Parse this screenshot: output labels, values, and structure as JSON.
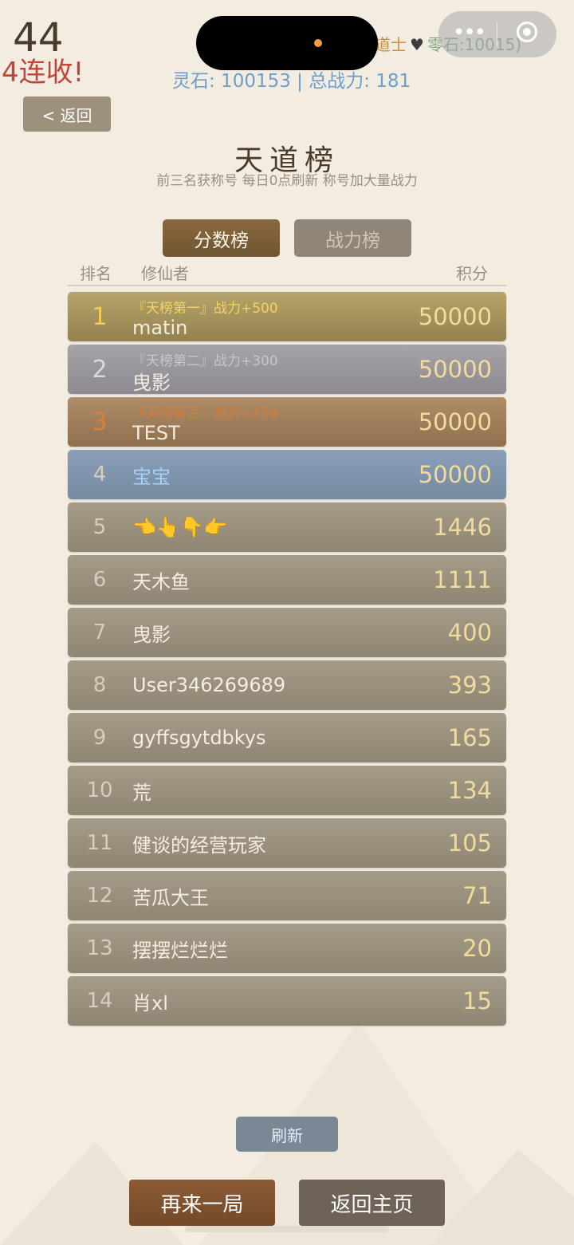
{
  "hud": {
    "score": "44",
    "streak": "4连收!",
    "status_title": "道士",
    "status_stone": "零石:10015",
    "status_stone_suffix": ")",
    "stats": "灵石: 100153 | 总战力: 181"
  },
  "back_label": "< 返回",
  "page": {
    "title": "天道榜",
    "subtitle": "前三名获称号 每日0点刷新 称号加大量战力"
  },
  "tabs": [
    {
      "label": "分数榜",
      "active": true
    },
    {
      "label": "战力榜",
      "active": false
    }
  ],
  "columns": {
    "rank": "排名",
    "player": "修仙者",
    "points": "积分"
  },
  "rows": [
    {
      "rank": "1",
      "title": "『天榜第一』战力+500",
      "name": "matin",
      "points": "50000"
    },
    {
      "rank": "2",
      "title": "『天榜第二』战力+300",
      "name": "曳影",
      "points": "50000"
    },
    {
      "rank": "3",
      "title": "『天榜第三』战力+150",
      "name": "TEST",
      "points": "50000"
    },
    {
      "rank": "4",
      "name": "宝宝",
      "points": "50000"
    },
    {
      "rank": "5",
      "name": "👈👆👇👉",
      "points": "1446"
    },
    {
      "rank": "6",
      "name": "天木鱼",
      "points": "1111"
    },
    {
      "rank": "7",
      "name": "曳影",
      "points": "400"
    },
    {
      "rank": "8",
      "name": "User346269689",
      "points": "393"
    },
    {
      "rank": "9",
      "name": "gyffsgytdbkys",
      "points": "165"
    },
    {
      "rank": "10",
      "name": "荒",
      "points": "134"
    },
    {
      "rank": "11",
      "name": "健谈的经营玩家",
      "points": "105"
    },
    {
      "rank": "12",
      "name": "苦瓜大王",
      "points": "71"
    },
    {
      "rank": "13",
      "name": "摆摆烂烂烂",
      "points": "20"
    },
    {
      "rank": "14",
      "name": "肖xl",
      "points": "15"
    }
  ],
  "buttons": {
    "refresh": "刷新",
    "play_again": "再来一局",
    "home": "返回主页"
  },
  "icons": {
    "more": "more-dots-icon",
    "close": "close-target-icon",
    "heart": "heart-icon"
  },
  "colors": {
    "background": "#f3ece0",
    "active_tab": "#7a5c36",
    "gold": "#f1cd58",
    "silver": "#d6d8e2",
    "bronze": "#d6803c",
    "self_row": "#7f95ad",
    "points": "#f1dc9e"
  }
}
